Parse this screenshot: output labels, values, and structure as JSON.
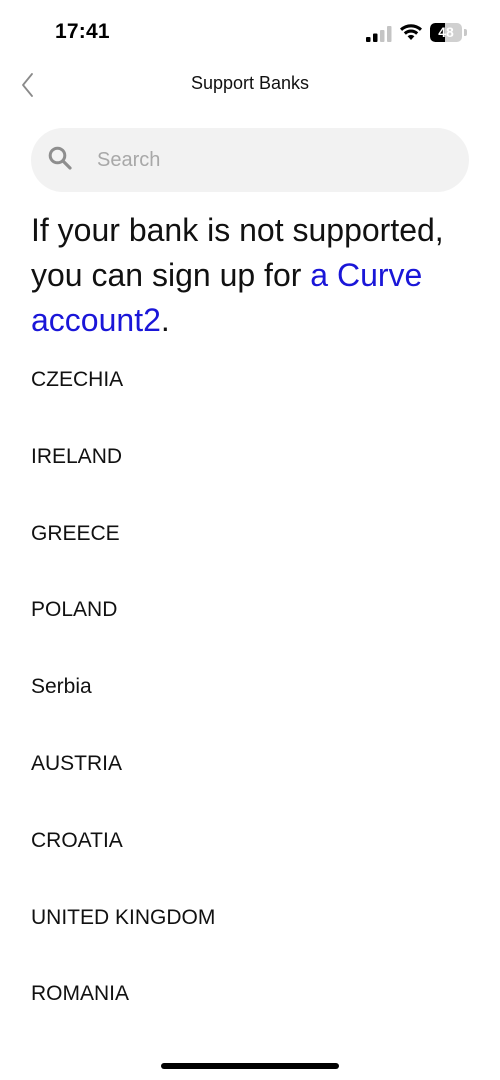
{
  "status_bar": {
    "time": "17:41",
    "battery_level": "48",
    "battery_percent": 48
  },
  "nav": {
    "title": "Support Banks"
  },
  "search": {
    "placeholder": "Search",
    "value": ""
  },
  "intro": {
    "text": "If your bank is not supported, you can sign up for ",
    "link_text": "a Curve account2",
    "suffix": "."
  },
  "countries": [
    "CZECHIA",
    "IRELAND",
    "GREECE",
    "POLAND",
    "Serbia",
    "AUSTRIA",
    "CROATIA",
    "UNITED KINGDOM",
    "ROMANIA"
  ],
  "colors": {
    "link": "#1a16d8",
    "search_background": "#f2f2f2"
  },
  "icons": {
    "back": "chevron-left-icon",
    "search": "search-icon",
    "signal": "cellular-signal-icon",
    "wifi": "wifi-icon",
    "battery": "battery-icon"
  }
}
